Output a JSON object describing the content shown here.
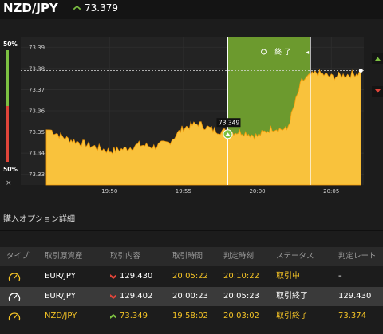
{
  "header": {
    "pair": "NZD/JPY",
    "rate": "73.379",
    "direction_icon": "up-arrow-icon"
  },
  "chart": {
    "left_pct_top": "50%",
    "left_pct_bottom": "50%",
    "close_label": "×",
    "y_ticks": [
      "73.39",
      "73.38",
      "73.37",
      "73.36",
      "73.35",
      "73.34",
      "73.33"
    ],
    "x_ticks": [
      "19:50",
      "19:55",
      "20:00",
      "20:05"
    ],
    "entry_label": "73.349",
    "end_label": "終 了",
    "colors": {
      "area": "#f9c23c",
      "zone": "#6c9a2e",
      "up": "#7dc142",
      "down": "#e0453a"
    }
  },
  "chart_data": {
    "type": "area",
    "x": [
      "19:46",
      "19:47",
      "19:48",
      "19:49",
      "19:50",
      "19:51",
      "19:52",
      "19:53",
      "19:54",
      "19:55",
      "19:56",
      "19:57",
      "19:58",
      "19:59",
      "20:00",
      "20:01",
      "20:02",
      "20:03",
      "20:04",
      "20:05",
      "20:06",
      "20:07"
    ],
    "values": [
      73.351,
      73.347,
      73.345,
      73.343,
      73.341,
      73.342,
      73.344,
      73.343,
      73.345,
      73.352,
      73.354,
      73.351,
      73.35,
      73.35,
      73.348,
      73.352,
      73.351,
      73.374,
      73.378,
      73.376,
      73.377,
      73.378
    ],
    "ylim": [
      73.325,
      73.395
    ],
    "current_rate": 73.379,
    "entry": {
      "time": "19:58",
      "rate": 73.349
    },
    "judgement_time": "20:03"
  },
  "detail": {
    "title": "購入オプション詳細",
    "columns": [
      "タイプ",
      "取引原資産",
      "取引内容",
      "取引時間",
      "判定時刻",
      "ステータス",
      "判定レート"
    ],
    "rows": [
      {
        "type_icon": "timer-icon",
        "asset": "EUR/JPY",
        "direction": "down",
        "content": "129.430",
        "trade_time": "20:05:22",
        "judge_time": "20:10:22",
        "status": "取引中",
        "judge_rate": "-"
      },
      {
        "type_icon": "timer-icon",
        "asset": "EUR/JPY",
        "direction": "down",
        "content": "129.402",
        "trade_time": "20:00:23",
        "judge_time": "20:05:23",
        "status": "取引終了",
        "judge_rate": "129.430"
      },
      {
        "type_icon": "timer-icon",
        "asset": "NZD/JPY",
        "direction": "up",
        "content": "73.349",
        "trade_time": "19:58:02",
        "judge_time": "20:03:02",
        "status": "取引終了",
        "judge_rate": "73.374"
      }
    ]
  }
}
